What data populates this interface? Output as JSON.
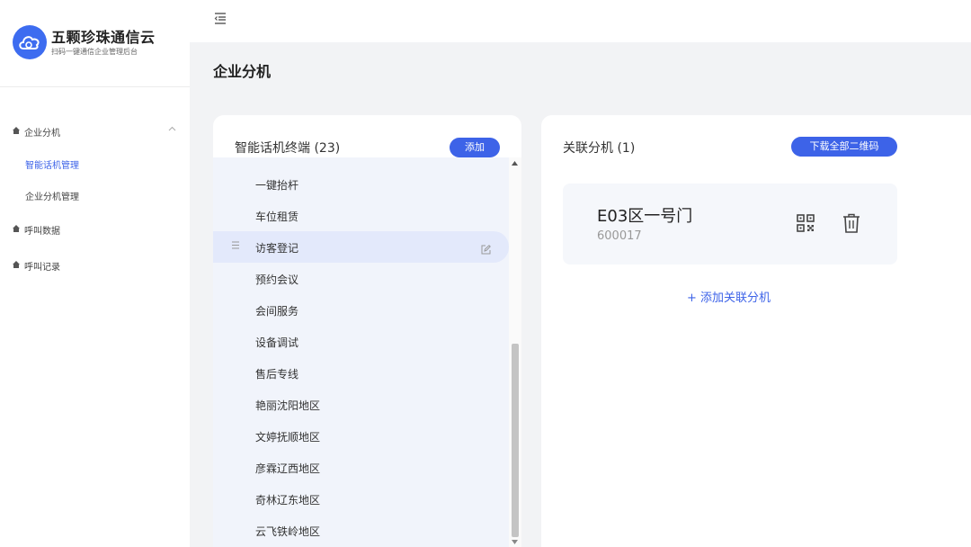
{
  "brand": {
    "name": "五颗珍珠通信云",
    "tagline": "扫码一键通信企业管理后台"
  },
  "sidebar": {
    "groups": [
      {
        "label": "企业分机",
        "expanded": true,
        "items": [
          {
            "label": "智能话机管理",
            "active": true
          },
          {
            "label": "企业分机管理",
            "active": false
          }
        ]
      },
      {
        "label": "呼叫数据"
      },
      {
        "label": "呼叫记录"
      }
    ]
  },
  "page": {
    "title": "企业分机"
  },
  "terminals": {
    "title": "智能话机终端 (23)",
    "add_label": "添加",
    "items": [
      "一键抬杆",
      "车位租赁",
      "访客登记",
      "预约会议",
      "会间服务",
      "设备调试",
      "售后专线",
      "艳丽沈阳地区",
      "文婷抚顺地区",
      "彦霖辽西地区",
      "奇林辽东地区",
      "云飞铁岭地区"
    ],
    "active_index": 2
  },
  "linked": {
    "title": "关联分机 (1)",
    "download_label": "下载全部二维码",
    "extensions": [
      {
        "name": "E03区一号门",
        "code": "600017"
      }
    ],
    "add_link": "+ 添加关联分机"
  },
  "colors": {
    "accent": "#3d63e8",
    "list_bg": "#f1f4fb",
    "active_row": "#e3e9fb",
    "page_bg": "#f2f3f5"
  }
}
